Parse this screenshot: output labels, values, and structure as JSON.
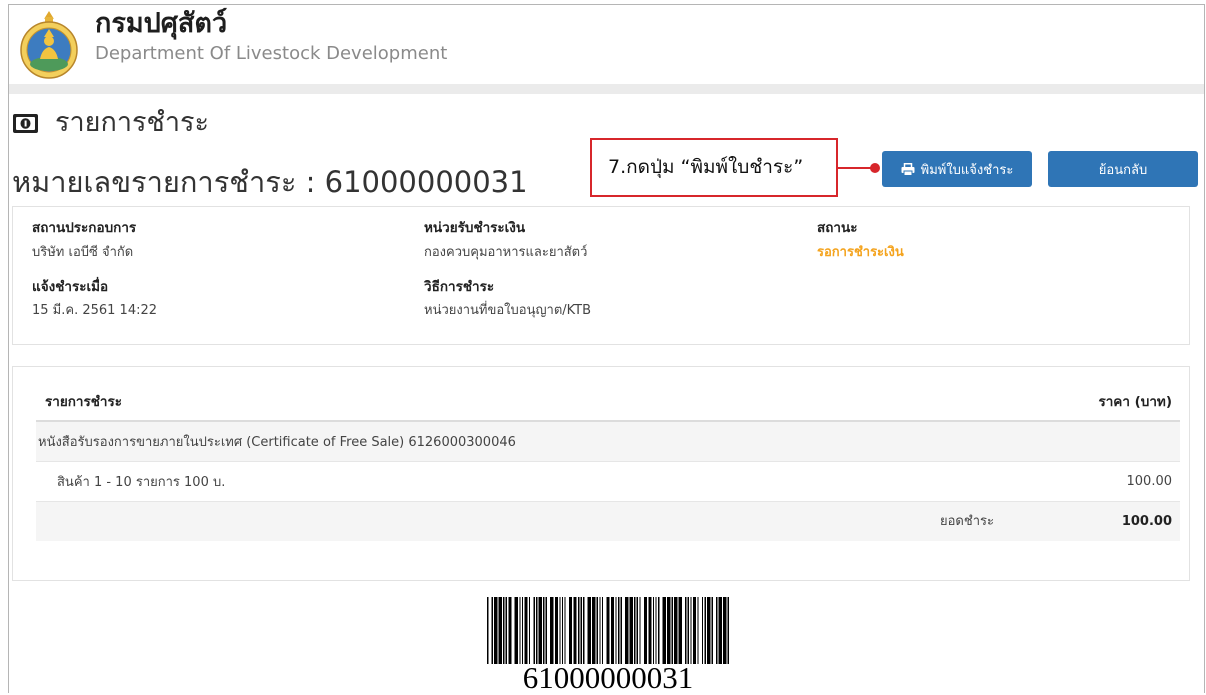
{
  "header": {
    "logo_icon": "dld-emblem-logo",
    "org_name_th": "กรมปศุสัตว์",
    "org_name_en": "Department Of Livestock Development"
  },
  "page": {
    "title_icon": "money-icon",
    "title": "รายการชำระ",
    "payment_no_label": "หมายเลขรายการชำระ :",
    "payment_no": "61000000031"
  },
  "annotation": {
    "text": "7.กดปุ่ม “พิมพ์ใบชำระ”"
  },
  "actions": {
    "print_icon": "print-icon",
    "print_label": "พิมพ์ใบแจ้งชำระ",
    "back_label": "ย้อนกลับ"
  },
  "info": {
    "business": {
      "label": "สถานประกอบการ",
      "value": "บริษัท เอบีซี จำกัด"
    },
    "notified_at": {
      "label": "แจ้งชำระเมื่อ",
      "value": "15 มี.ค. 2561 14:22"
    },
    "receiver": {
      "label": "หน่วยรับชำระเงิน",
      "value": "กองควบคุมอาหารและยาสัตว์"
    },
    "method": {
      "label": "วิธีการชำระ",
      "value": "หน่วยงานที่ขอใบอนุญาต/KTB"
    },
    "status": {
      "label": "สถานะ",
      "value": "รอการชำระเงิน"
    }
  },
  "items_table": {
    "headers": [
      "รายการชำระ",
      "ราคา (บาท)"
    ],
    "document": "หนังสือรับรองการขายภายในประเทศ (Certificate of Free Sale) 6126000300046",
    "lines": [
      {
        "description": "สินค้า 1 - 10 รายการ 100 บ.",
        "price": "100.00"
      }
    ],
    "total_label": "ยอดชำระ",
    "total": "100.00"
  },
  "barcode": {
    "value": "61000000031"
  },
  "colors": {
    "primary": "#2f75b6",
    "annotation": "#d7262b",
    "status_pending": "#f4a31d",
    "header_band": "#ebebeb"
  }
}
